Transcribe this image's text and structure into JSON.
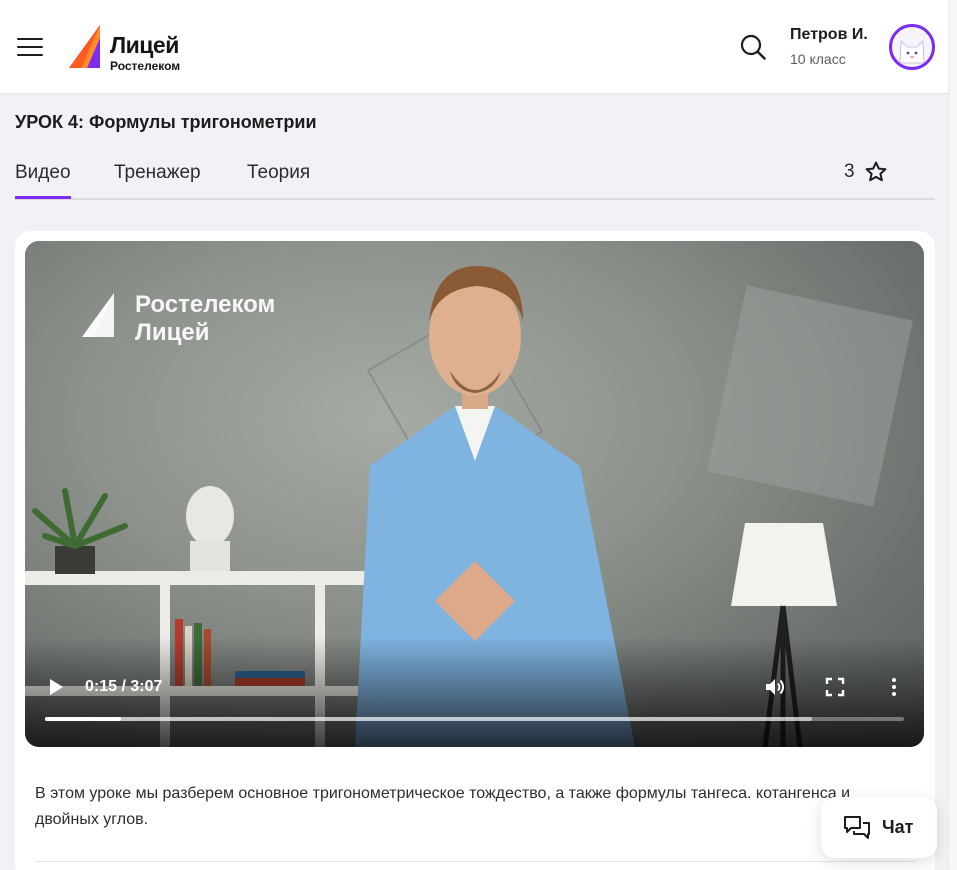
{
  "header": {
    "logo_title": "Лицей",
    "logo_subtitle": "Ростелеком",
    "user_name": "Петров И.",
    "user_grade": "10 класс"
  },
  "lesson": {
    "title": "УРОК 4: Формулы тригонометрии",
    "tabs": [
      {
        "label": "Видео",
        "active": true
      },
      {
        "label": "Тренажер",
        "active": false
      },
      {
        "label": "Теория",
        "active": false
      }
    ],
    "rating": "3"
  },
  "video": {
    "watermark_line1": "Ростелеком",
    "watermark_line2": "Лицей",
    "current_time": "0:15 / 3:07",
    "progress_fraction": 0.0885,
    "buffered_fraction": 0.893
  },
  "description": "В этом уроке мы разберем основное тригонометрическое тождество, а также формулы тангеса. котангенса и двойных углов.",
  "chat": {
    "label": "Чат"
  },
  "colors": {
    "accent": "#7b2cf0",
    "logo_orange": "#ff5a1f",
    "background": "#f0f2f5"
  },
  "icons": [
    "menu-icon",
    "search-icon",
    "star-icon",
    "play-icon",
    "volume-icon",
    "fullscreen-icon",
    "more-vertical-icon",
    "chat-icon"
  ]
}
